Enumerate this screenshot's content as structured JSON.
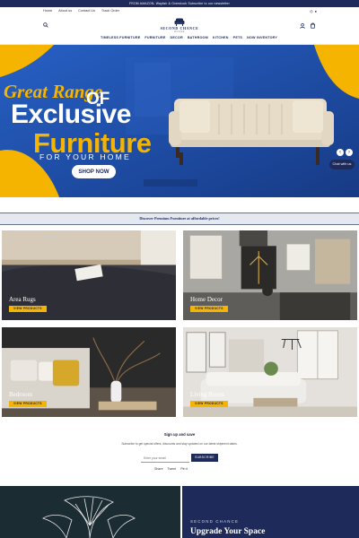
{
  "announcement": {
    "text": "FROM AMAZON, Wayfair & Overstock Subscribe to our newsletter"
  },
  "topnav": {
    "links": [
      "Home",
      "About us",
      "Contact Us",
      "Track Order"
    ],
    "social_icons": [
      "instagram-icon",
      "facebook-icon"
    ]
  },
  "header": {
    "logo_name": "SECOND CHANCE",
    "logo_sub": "HOUSE",
    "icons": [
      "search-icon",
      "account-icon",
      "cart-icon"
    ],
    "nav": [
      "TIMELESS FURNITURE",
      "FURNITURE",
      "DECOR",
      "BATHROOM",
      "KITCHEN",
      "PETS",
      "NOW INVENTORY"
    ]
  },
  "hero": {
    "script_line": "Great Range",
    "of_word": "OF",
    "line1": "Exclusive",
    "line2": "Furniture",
    "line3": "FOR YOUR HOME",
    "cta": "SHOP NOW",
    "chat": "Chat with us",
    "prev": "‹",
    "next": "›"
  },
  "promo": {
    "text": "Discover Premium Furniture at affordable prices!"
  },
  "categories": [
    {
      "title": "Area Rugs",
      "button": "VIEW PRODUCTS"
    },
    {
      "title": "Home Decor",
      "button": "VIEW PRODUCTS"
    },
    {
      "title": "Bedroom",
      "button": "VIEW PRODUCTS"
    },
    {
      "title": "Living Room",
      "button": "VIEW PRODUCTS"
    }
  ],
  "signup": {
    "title": "Sign up and save",
    "description": "Subscribe to get special offers, discounts and stay updated on our latest shipment dates.",
    "email_placeholder": "Enter your email",
    "button": "SUBSCRIBE",
    "share": [
      "Share",
      "Tweet",
      "Pin it"
    ]
  },
  "bottom": {
    "eyebrow": "SECOND CHANCE",
    "heading": "Upgrade Your Space"
  },
  "colors": {
    "navy": "#1e2a5a",
    "accent_yellow": "#f5b400",
    "hero_blue": "#1f4ea8"
  }
}
